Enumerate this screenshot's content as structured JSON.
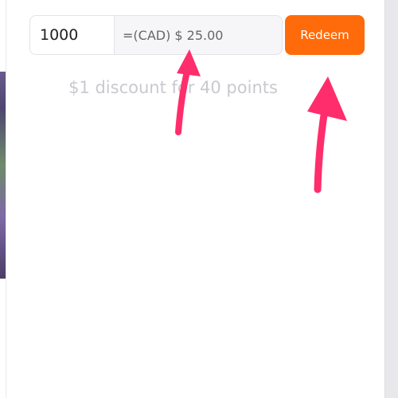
{
  "redeem": {
    "points_value": "1000",
    "conversion_text": "=(CAD) $ 25.00",
    "button_label": "Redeem"
  },
  "discount_note": "$1 discount for 40 points",
  "colors": {
    "accent": "#ff6b0a",
    "annotation_arrow": "#ff2d6b",
    "muted_text": "#c9c9cf"
  }
}
